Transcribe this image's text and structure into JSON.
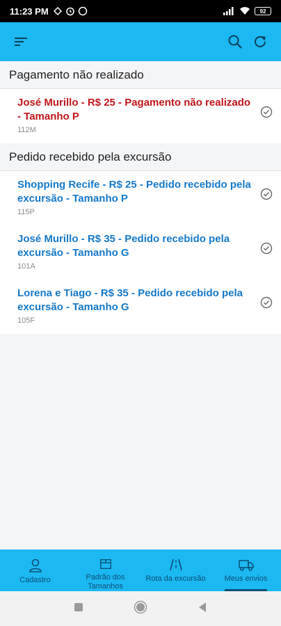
{
  "status_bar": {
    "time": "11:23 PM",
    "battery": "92"
  },
  "app_bar": {
    "menu_icon": "menu-icon",
    "search_icon": "search-icon",
    "refresh_icon": "refresh-icon"
  },
  "sections": [
    {
      "title": "Pagamento não realizado",
      "items": [
        {
          "title": "José Murillo - R$ 25 - Pagamento não realizado - Tamanho P",
          "code": "112M",
          "color": "#c0161b"
        }
      ]
    },
    {
      "title": "Pedido recebido pela excursão",
      "items": [
        {
          "title": "Shopping Recife - R$ 25 - Pedido recebido pela excursão - Tamanho P",
          "code": "115P",
          "color": "#1679c9"
        },
        {
          "title": "José Murillo - R$ 35 - Pedido recebido pela excursão - Tamanho G",
          "code": "101A",
          "color": "#1679c9"
        },
        {
          "title": "Lorena e Tiago - R$ 35 - Pedido recebido pela excursão - Tamanho G",
          "code": "105F",
          "color": "#1679c9"
        }
      ]
    }
  ],
  "bottom_nav": [
    {
      "label": "Cadastro",
      "icon": "person-icon"
    },
    {
      "label": "Padrão dos Tamanhos",
      "icon": "box-icon"
    },
    {
      "label": "Rota da excursão",
      "icon": "road-icon"
    },
    {
      "label": "Meus envios",
      "icon": "truck-icon",
      "active": true
    }
  ]
}
